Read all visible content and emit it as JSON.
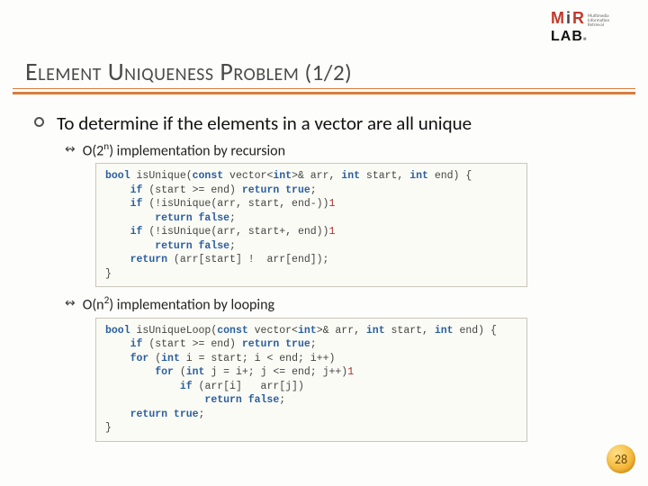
{
  "logo": {
    "m": "M",
    "i": "i",
    "r": "R",
    "lab": "LAB",
    "sub": "Multimedia\nInformation\nRetrieval"
  },
  "title": {
    "t1": "E",
    "t2": "LEMENT",
    "t3": " U",
    "t4": "NIQUENESS",
    "t5": " P",
    "t6": "ROBLEM",
    "suffix": " (1/2)"
  },
  "bullets": {
    "main": "To determine if the elements in a vector are all unique",
    "sub1_pre": "O(2",
    "sub1_sup": "n",
    "sub1_post": ") implementation by recursion",
    "sub2_pre": "O(n",
    "sub2_sup": "2",
    "sub2_post": ") implementation by looping"
  },
  "code1": [
    {
      "kw": "bool",
      "rest": " isUnique(",
      "kw2": "const",
      "rest2": " vector<",
      "kw3": "int",
      "rest3": ">& arr, ",
      "kw4": "int",
      "rest4": " start, ",
      "kw5": "int",
      "rest5": " end) {"
    },
    {
      "indent": "    ",
      "kw": "if",
      "rest": " (start >= end) ",
      "kw2": "return true",
      "rest2": ";"
    },
    {
      "indent": "    ",
      "kw": "if",
      "rest": " (!isUnique(arr, start, end-",
      "num": "1",
      "rest2": "))"
    },
    {
      "indent": "        ",
      "kw": "return false",
      "rest": ";"
    },
    {
      "indent": "    ",
      "kw": "if",
      "rest": " (!isUnique(arr, start+",
      "num": "1",
      "rest2": ", end))"
    },
    {
      "indent": "        ",
      "kw": "return false",
      "rest": ";"
    },
    {
      "indent": "    ",
      "kw": "return",
      "rest": " (arr[start] !  arr[end]);"
    },
    {
      "indent": "",
      "rest": "}"
    }
  ],
  "code2": [
    {
      "kw": "bool",
      "rest": " isUniqueLoop(",
      "kw2": "const",
      "rest2": " vector<",
      "kw3": "int",
      "rest3": ">& arr, ",
      "kw4": "int",
      "rest4": " start, ",
      "kw5": "int",
      "rest5": " end) {"
    },
    {
      "indent": "    ",
      "kw": "if",
      "rest": " (start >= end) ",
      "kw2": "return true",
      "rest2": ";"
    },
    {
      "indent": "    ",
      "kw": "for",
      "rest": " (",
      "kw2": "int",
      "rest2": " i = start; i < end; i++)"
    },
    {
      "indent": "        ",
      "kw": "for",
      "rest": " (",
      "kw2": "int",
      "rest2": " j = i+",
      "num": "1",
      "rest3": "; j <= end; j++)"
    },
    {
      "indent": "            ",
      "kw": "if",
      "rest": " (arr[i]   arr[j])"
    },
    {
      "indent": "                ",
      "kw": "return false",
      "rest": ";"
    },
    {
      "indent": "    ",
      "kw": "return true",
      "rest": ";"
    },
    {
      "indent": "",
      "rest": "}"
    }
  ],
  "slide_number": "28"
}
